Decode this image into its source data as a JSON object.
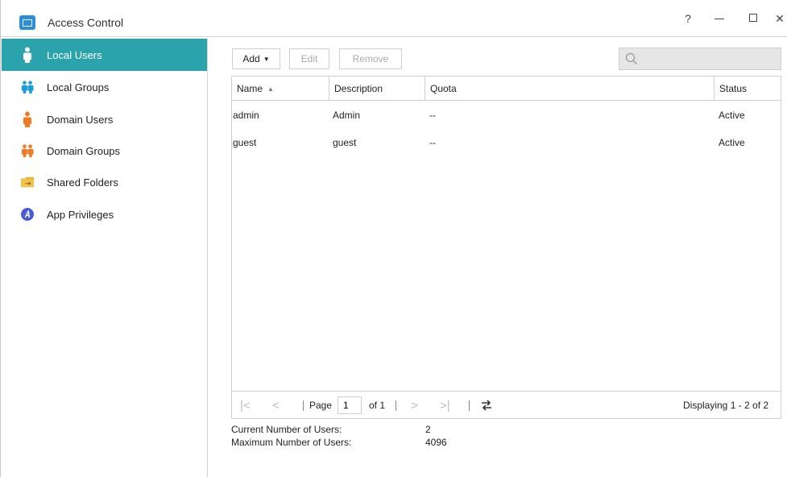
{
  "window": {
    "title": "Access Control",
    "help_label": "?",
    "close_label": "✕"
  },
  "sidebar": {
    "items": [
      {
        "label": "Local Users",
        "icon": "user-icon",
        "active": true
      },
      {
        "label": "Local Groups",
        "icon": "group-icon",
        "active": false
      },
      {
        "label": "Domain Users",
        "icon": "domain-user-icon",
        "active": false
      },
      {
        "label": "Domain Groups",
        "icon": "domain-group-icon",
        "active": false
      },
      {
        "label": "Shared Folders",
        "icon": "folder-icon",
        "active": false
      },
      {
        "label": "App Privileges",
        "icon": "app-privilege-icon",
        "active": false
      }
    ]
  },
  "toolbar": {
    "add_label": "Add",
    "edit_label": "Edit",
    "remove_label": "Remove",
    "search_placeholder": ""
  },
  "table": {
    "columns": [
      "Name",
      "Description",
      "Quota",
      "Status"
    ],
    "rows": [
      {
        "name": "admin",
        "description": "Admin",
        "quota": "--",
        "status": "Active"
      },
      {
        "name": "guest",
        "description": "guest",
        "quota": "--",
        "status": "Active"
      }
    ]
  },
  "pager": {
    "page_label": "Page",
    "page_value": "1",
    "of_label": "of 1",
    "displaying": "Displaying 1 - 2 of 2"
  },
  "stats": {
    "current_label": "Current Number of Users:",
    "current_value": "2",
    "max_label": "Maximum Number of Users:",
    "max_value": "4096"
  },
  "colors": {
    "accent": "#2aa3ad",
    "user_blue": "#1e9ed9",
    "domain_orange": "#f07a26"
  }
}
